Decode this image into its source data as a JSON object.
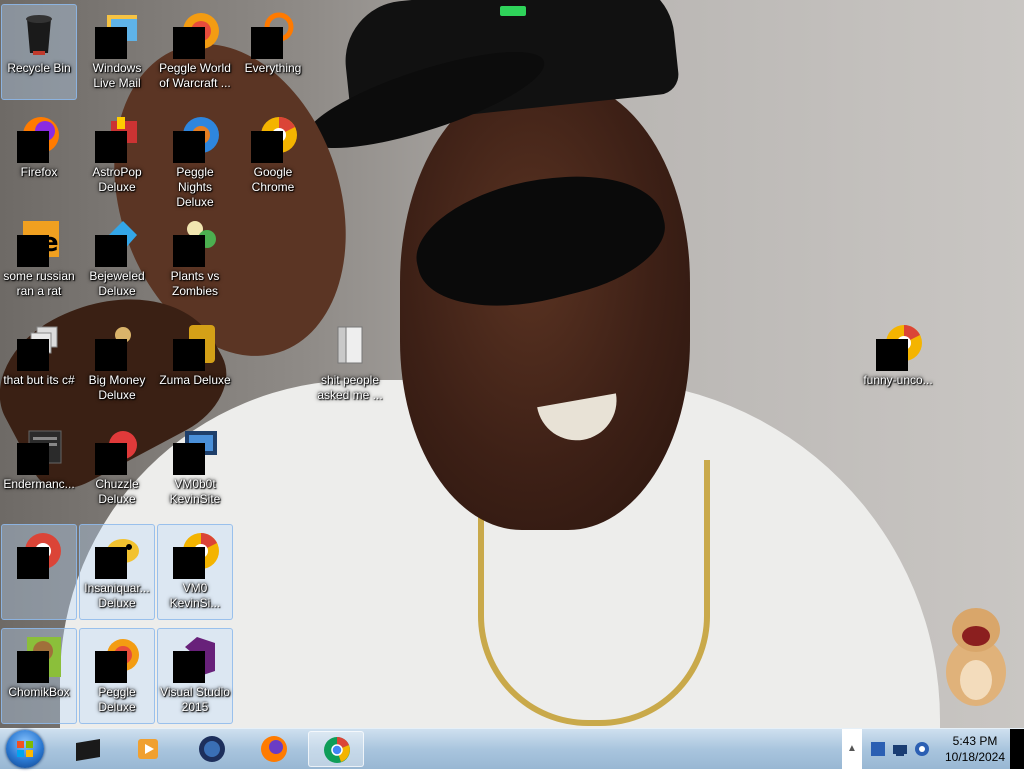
{
  "desktop": {
    "icons": [
      {
        "label": "Recycle Bin",
        "icon": "recycle-bin-icon"
      },
      {
        "label": "Windows Live Mail",
        "icon": "mail-icon"
      },
      {
        "label": "Peggle World of Warcraft ...",
        "icon": "peggle-icon"
      },
      {
        "label": "Everything",
        "icon": "search-icon"
      },
      {
        "label": "Firefox",
        "icon": "firefox-icon"
      },
      {
        "label": "AstroPop Deluxe",
        "icon": "astropop-icon"
      },
      {
        "label": "Peggle Nights Deluxe",
        "icon": "peggle-nights-icon"
      },
      {
        "label": "Google Chrome",
        "icon": "chrome-icon"
      },
      {
        "label": "some russian ran a rat",
        "icon": "app-icon"
      },
      {
        "label": "Bejeweled Deluxe",
        "icon": "bejeweled-icon"
      },
      {
        "label": "Plants vs Zombies",
        "icon": "pvz-icon"
      },
      {
        "label": "that but its c#",
        "icon": "shortcut-icon"
      },
      {
        "label": "Big Money Deluxe",
        "icon": "big-money-icon"
      },
      {
        "label": "Zuma Deluxe",
        "icon": "zuma-icon"
      },
      {
        "label": "shit people asked me ...",
        "icon": "folder-icon"
      },
      {
        "label": "funny-unco...",
        "icon": "chrome-icon"
      },
      {
        "label": "Endermanc...",
        "icon": "app-icon"
      },
      {
        "label": "Chuzzle Deluxe",
        "icon": "chuzzle-icon"
      },
      {
        "label": "VM0b0t KevinSite",
        "icon": "vm-icon"
      },
      {
        "label": "",
        "icon": "chrome-icon"
      },
      {
        "label": "Insaniquar... Deluxe",
        "icon": "insaniquarium-icon"
      },
      {
        "label": "VM0 KevinSi...",
        "icon": "chrome-icon"
      },
      {
        "label": "ChomikBox",
        "icon": "chomikbox-icon"
      },
      {
        "label": "Peggle Deluxe",
        "icon": "peggle-icon"
      },
      {
        "label": "Visual Studio 2015",
        "icon": "visual-studio-icon"
      }
    ]
  },
  "taskbar": {
    "pinned": [
      {
        "name": "start",
        "icon": "windows-start-icon"
      },
      {
        "name": "command-prompt",
        "icon": "terminal-icon"
      },
      {
        "name": "media-player",
        "icon": "media-player-icon"
      },
      {
        "name": "app-globe",
        "icon": "globe-icon"
      },
      {
        "name": "firefox",
        "icon": "firefox-icon"
      },
      {
        "name": "chrome",
        "icon": "chrome-icon"
      }
    ],
    "tray": {
      "time": "5:43 PM",
      "date": "10/18/2024",
      "icons": [
        "show-hidden-icons-icon",
        "app-tray-icon",
        "network-icon",
        "volume-icon"
      ]
    }
  },
  "colors": {
    "taskbar_top": "#cfe0ef",
    "taskbar_bottom": "#98b7d3",
    "selection": "#bedcff",
    "label_text": "#ffffff"
  }
}
